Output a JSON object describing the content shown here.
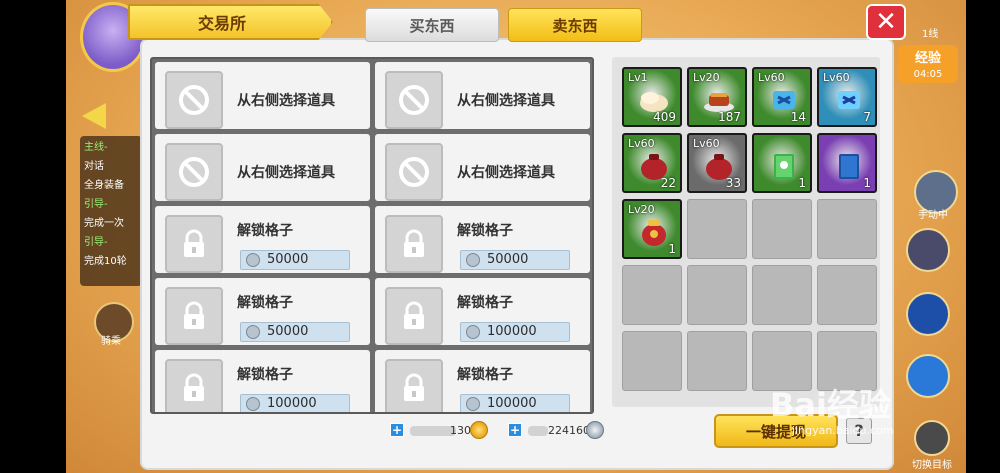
{
  "dialog": {
    "title": "交易所",
    "tabs": [
      {
        "label": "买东西",
        "active": false
      },
      {
        "label": "卖东西",
        "active": true
      }
    ],
    "close_label": "✕"
  },
  "slots": {
    "select_items": [
      {
        "label": "从右侧选择道具"
      },
      {
        "label": "从右侧选择道具"
      },
      {
        "label": "从右侧选择道具"
      },
      {
        "label": "从右侧选择道具"
      }
    ],
    "locked_items": [
      {
        "label": "解锁格子",
        "price": "50000"
      },
      {
        "label": "解锁格子",
        "price": "50000"
      },
      {
        "label": "解锁格子",
        "price": "50000"
      },
      {
        "label": "解锁格子",
        "price": "100000"
      },
      {
        "label": "解锁格子",
        "price": "100000"
      },
      {
        "label": "解锁格子",
        "price": "100000"
      }
    ]
  },
  "bag": {
    "items": [
      {
        "level": "Lv1",
        "qty": "409",
        "art": "dumpling",
        "color": "#3e8a2c"
      },
      {
        "level": "Lv20",
        "qty": "187",
        "art": "meat-dish",
        "color": "#3e8a2c"
      },
      {
        "level": "Lv60",
        "qty": "14",
        "art": "blue-scroll",
        "color": "#3e8a2c"
      },
      {
        "level": "Lv60",
        "qty": "7",
        "art": "blue-scroll-glow",
        "color": "#2f8fb8"
      },
      {
        "level": "Lv60",
        "qty": "22",
        "art": "red-pouch",
        "color": "#3e8a2c"
      },
      {
        "level": "Lv60",
        "qty": "33",
        "art": "red-pouch",
        "color": "#6b6b6b"
      },
      {
        "level": "",
        "qty": "1",
        "art": "green-book",
        "color": "#3e8a2c"
      },
      {
        "level": "",
        "qty": "1",
        "art": "blue-book",
        "color": "#7a3fb3"
      },
      {
        "level": "Lv20",
        "qty": "1",
        "art": "red-jar",
        "color": "#3e8a2c"
      }
    ],
    "empty_count": 11
  },
  "currency": {
    "gold_value": "130",
    "silver_value": "224160"
  },
  "footer": {
    "withdraw_label": "一键提现",
    "help_label": "?"
  },
  "hud": {
    "quest_lines": [
      {
        "text": "主线-",
        "green": true
      },
      {
        "text": "对话",
        "green": false
      },
      {
        "text": "全身装备",
        "green": false
      },
      {
        "text": "引导-",
        "green": true
      },
      {
        "text": "完成一次",
        "green": false
      },
      {
        "text": "引导-",
        "green": true
      },
      {
        "text": "完成10轮",
        "green": false
      }
    ],
    "mount_label": "骑乘",
    "manual_label": "手动中",
    "switch_target_label": "切换目标",
    "exp_label": "经验",
    "exp_time": "04:05",
    "line_label": "1线"
  },
  "watermark": {
    "text": "Bai经验",
    "url": "jingyan.baidu.com"
  },
  "colors": {
    "accent_yellow": "#f4c32a",
    "close_red": "#e0303c",
    "bag_green": "#3e8a2c"
  }
}
